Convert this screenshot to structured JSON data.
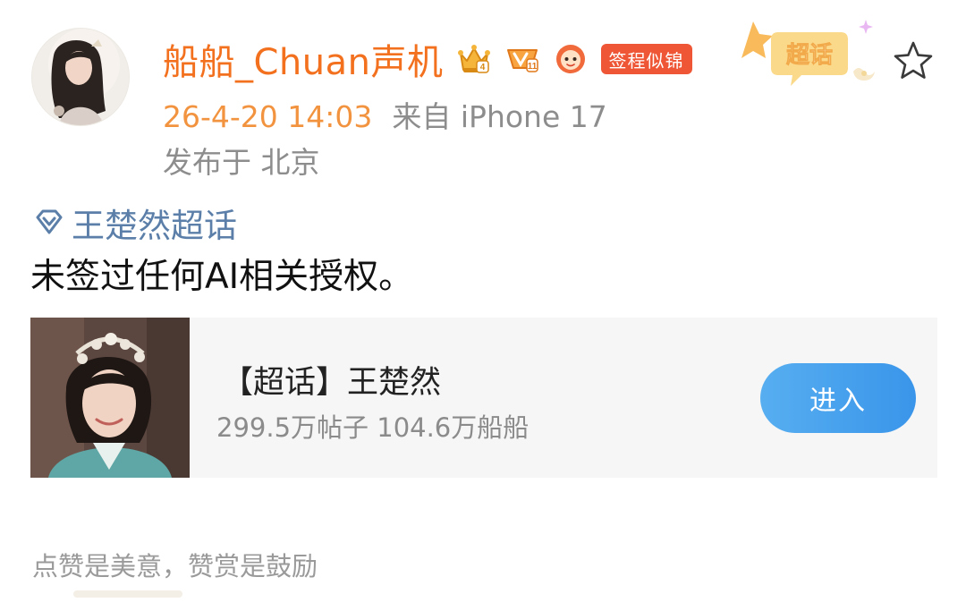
{
  "user": {
    "name": "船船_Chuan声机",
    "avatar_icon": "avatar-portrait",
    "badges": [
      "crown-badge-icon",
      "vip-level-badge-icon",
      "fan-badge-icon"
    ],
    "tag_label": "签程似锦"
  },
  "meta": {
    "time": "26-4-20 14:03",
    "source": "来自 iPhone 17",
    "location": "发布于 北京"
  },
  "header": {
    "sticker_label": "超话",
    "star_icon": "star-outline-icon"
  },
  "post": {
    "topic_label": "王楚然超话",
    "topic_icon": "diamond-icon",
    "text": "未签过任何AI相关授权。"
  },
  "card": {
    "title": "【超话】王楚然",
    "stats": "299.5万帖子 104.6万船船",
    "button_label": "进入"
  },
  "footer": {
    "text": "点赞是美意，赞赏是鼓励"
  },
  "colors": {
    "username": "#f2701e",
    "time": "#f2933f",
    "meta_gray": "#8d8d8d",
    "topic_link": "#5b7fa8",
    "tag_red": "#ee5635",
    "button_blue": "#3a95ea",
    "card_bg": "#f6f6f6"
  }
}
